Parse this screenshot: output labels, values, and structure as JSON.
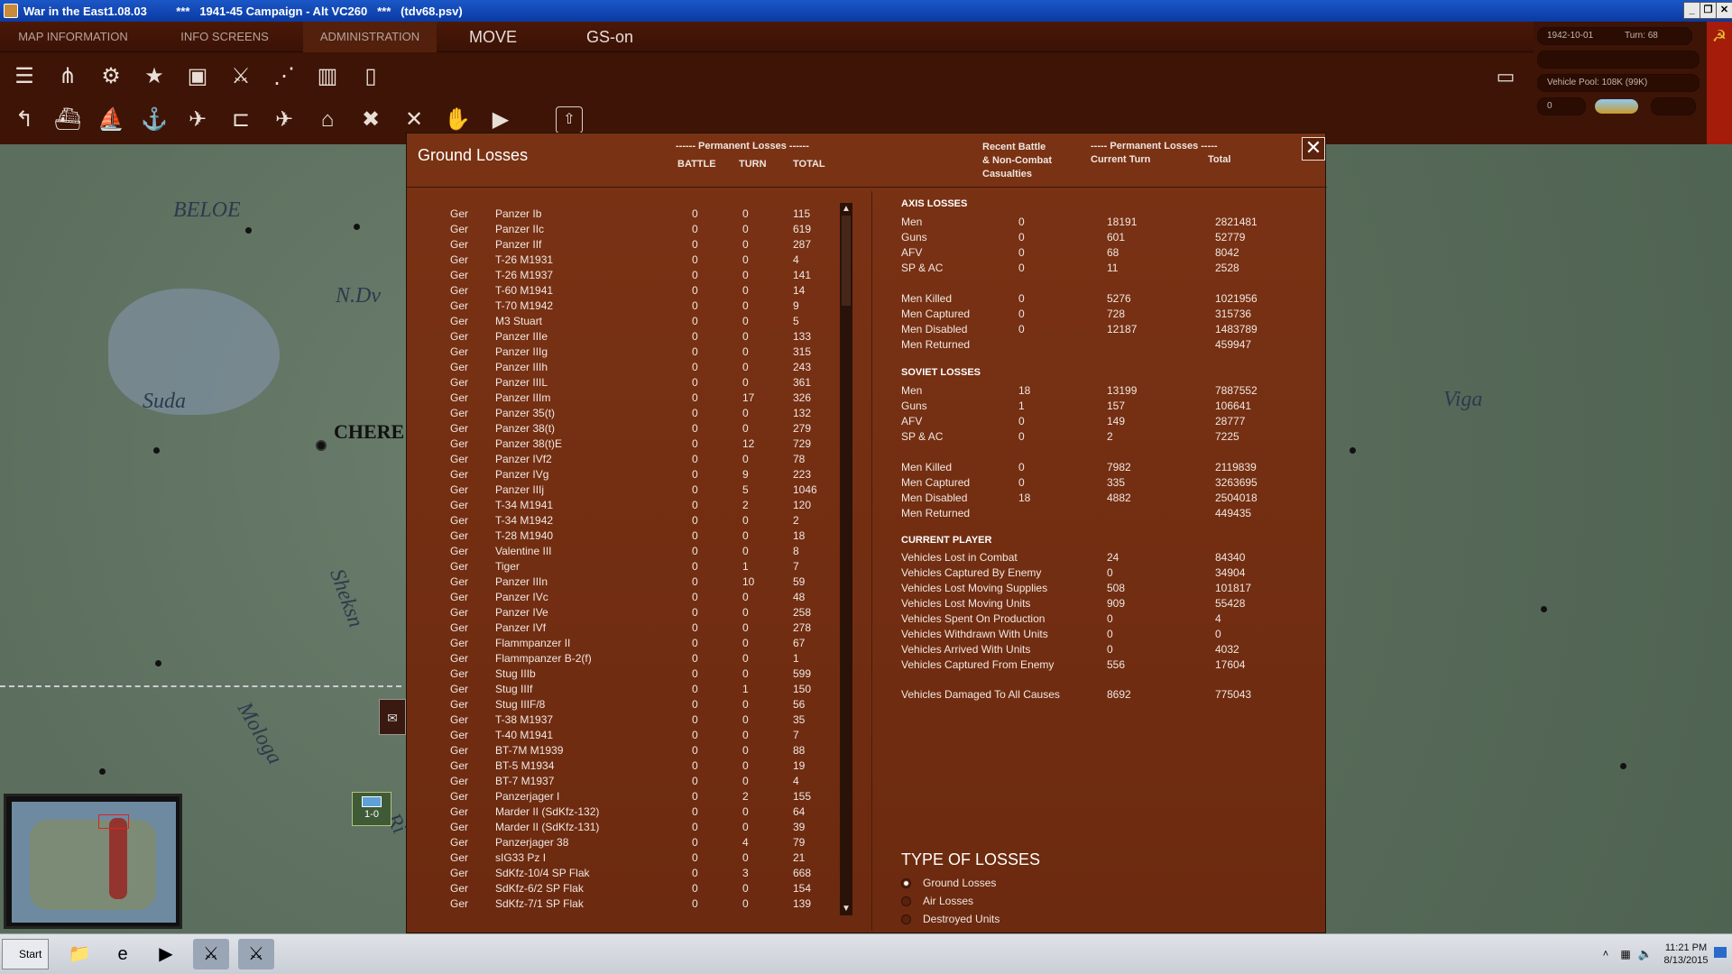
{
  "window": {
    "title": "War in the East1.08.03         ***   1941-45 Campaign - Alt VC260   ***   (tdv68.psv)",
    "minimize": "_",
    "restore": "❐",
    "close": "✕"
  },
  "menubar": {
    "tabs": [
      "MAP INFORMATION",
      "INFO SCREENS",
      "ADMINISTRATION"
    ],
    "mode": "MOVE",
    "gs": "GS-on"
  },
  "hud": {
    "date": "1942-10-01",
    "turn": "Turn: 68",
    "vehicle_pool": "Vehicle Pool: 108K (99K)",
    "small_value": "0"
  },
  "map": {
    "labels": [
      "BELOE",
      "N.Dv",
      "Suda",
      "CHERE",
      "Sheksn",
      "Mologa",
      "Viga",
      "Ri"
    ],
    "unit_label": "1-0"
  },
  "panel": {
    "title": "Ground Losses",
    "left_header_group": "------ Permanent Losses ------",
    "left_cols": [
      "BATTLE",
      "TURN",
      "TOTAL"
    ],
    "right_header_1": "Recent Battle\n& Non-Combat\nCasualties",
    "right_header_group": "----- Permanent Losses -----",
    "right_cols": [
      "Current Turn",
      "Total"
    ],
    "close_label": "✕"
  },
  "losses": [
    [
      "Ger",
      "Panzer Ib",
      "0",
      "0",
      "115"
    ],
    [
      "Ger",
      "Panzer IIc",
      "0",
      "0",
      "619"
    ],
    [
      "Ger",
      "Panzer IIf",
      "0",
      "0",
      "287"
    ],
    [
      "Ger",
      "T-26 M1931",
      "0",
      "0",
      "4"
    ],
    [
      "Ger",
      "T-26 M1937",
      "0",
      "0",
      "141"
    ],
    [
      "Ger",
      "T-60 M1941",
      "0",
      "0",
      "14"
    ],
    [
      "Ger",
      "T-70 M1942",
      "0",
      "0",
      "9"
    ],
    [
      "Ger",
      "M3 Stuart",
      "0",
      "0",
      "5"
    ],
    [
      "Ger",
      "Panzer IIIe",
      "0",
      "0",
      "133"
    ],
    [
      "Ger",
      "Panzer IIIg",
      "0",
      "0",
      "315"
    ],
    [
      "Ger",
      "Panzer IIIh",
      "0",
      "0",
      "243"
    ],
    [
      "Ger",
      "Panzer IIIL",
      "0",
      "0",
      "361"
    ],
    [
      "Ger",
      "Panzer IIIm",
      "0",
      "17",
      "326"
    ],
    [
      "Ger",
      "Panzer 35(t)",
      "0",
      "0",
      "132"
    ],
    [
      "Ger",
      "Panzer 38(t)",
      "0",
      "0",
      "279"
    ],
    [
      "Ger",
      "Panzer 38(t)E",
      "0",
      "12",
      "729"
    ],
    [
      "Ger",
      "Panzer IVf2",
      "0",
      "0",
      "78"
    ],
    [
      "Ger",
      "Panzer IVg",
      "0",
      "9",
      "223"
    ],
    [
      "Ger",
      "Panzer IIIj",
      "0",
      "5",
      "1046"
    ],
    [
      "Ger",
      "T-34 M1941",
      "0",
      "2",
      "120"
    ],
    [
      "Ger",
      "T-34 M1942",
      "0",
      "0",
      "2"
    ],
    [
      "Ger",
      "T-28 M1940",
      "0",
      "0",
      "18"
    ],
    [
      "Ger",
      "Valentine III",
      "0",
      "0",
      "8"
    ],
    [
      "Ger",
      "Tiger",
      "0",
      "1",
      "7"
    ],
    [
      "Ger",
      "Panzer IIIn",
      "0",
      "10",
      "59"
    ],
    [
      "Ger",
      "Panzer IVc",
      "0",
      "0",
      "48"
    ],
    [
      "Ger",
      "Panzer IVe",
      "0",
      "0",
      "258"
    ],
    [
      "Ger",
      "Panzer IVf",
      "0",
      "0",
      "278"
    ],
    [
      "Ger",
      "Flammpanzer II",
      "0",
      "0",
      "67"
    ],
    [
      "Ger",
      "Flammpanzer B-2(f)",
      "0",
      "0",
      "1"
    ],
    [
      "Ger",
      "Stug IIIb",
      "0",
      "0",
      "599"
    ],
    [
      "Ger",
      "Stug IIIf",
      "0",
      "1",
      "150"
    ],
    [
      "Ger",
      "Stug IIIF/8",
      "0",
      "0",
      "56"
    ],
    [
      "Ger",
      "T-38 M1937",
      "0",
      "0",
      "35"
    ],
    [
      "Ger",
      "T-40 M1941",
      "0",
      "0",
      "7"
    ],
    [
      "Ger",
      "BT-7M M1939",
      "0",
      "0",
      "88"
    ],
    [
      "Ger",
      "BT-5 M1934",
      "0",
      "0",
      "19"
    ],
    [
      "Ger",
      "BT-7 M1937",
      "0",
      "0",
      "4"
    ],
    [
      "Ger",
      "Panzerjager I",
      "0",
      "2",
      "155"
    ],
    [
      "Ger",
      "Marder II (SdKfz-132)",
      "0",
      "0",
      "64"
    ],
    [
      "Ger",
      "Marder II (SdKfz-131)",
      "0",
      "0",
      "39"
    ],
    [
      "Ger",
      "Panzerjager 38",
      "0",
      "4",
      "79"
    ],
    [
      "Ger",
      "sIG33 Pz I",
      "0",
      "0",
      "21"
    ],
    [
      "Ger",
      "SdKfz-10/4 SP Flak",
      "0",
      "3",
      "668"
    ],
    [
      "Ger",
      "SdKfz-6/2 SP Flak",
      "0",
      "0",
      "154"
    ],
    [
      "Ger",
      "SdKfz-7/1 SP Flak",
      "0",
      "0",
      "139"
    ]
  ],
  "axis": {
    "title": "AXIS LOSSES",
    "rows": [
      [
        "Men",
        "0",
        "18191",
        "2821481"
      ],
      [
        "Guns",
        "0",
        "601",
        "52779"
      ],
      [
        "AFV",
        "0",
        "68",
        "8042"
      ],
      [
        "SP & AC",
        "0",
        "11",
        "2528"
      ]
    ],
    "rows2": [
      [
        "Men Killed",
        "0",
        "5276",
        "1021956"
      ],
      [
        "Men Captured",
        "0",
        "728",
        "315736"
      ],
      [
        "Men Disabled",
        "0",
        "12187",
        "1483789"
      ],
      [
        "Men Returned",
        "",
        "",
        "459947"
      ]
    ]
  },
  "soviet": {
    "title": "SOVIET LOSSES",
    "rows": [
      [
        "Men",
        "18",
        "13199",
        "7887552"
      ],
      [
        "Guns",
        "1",
        "157",
        "106641"
      ],
      [
        "AFV",
        "0",
        "149",
        "28777"
      ],
      [
        "SP & AC",
        "0",
        "2",
        "7225"
      ]
    ],
    "rows2": [
      [
        "Men Killed",
        "0",
        "7982",
        "2119839"
      ],
      [
        "Men Captured",
        "0",
        "335",
        "3263695"
      ],
      [
        "Men Disabled",
        "18",
        "4882",
        "2504018"
      ],
      [
        "Men Returned",
        "",
        "",
        "449435"
      ]
    ]
  },
  "current_player": {
    "title": "CURRENT PLAYER",
    "rows": [
      [
        "Vehicles Lost in Combat",
        "24",
        "84340"
      ],
      [
        "Vehicles Captured By Enemy",
        "0",
        "34904"
      ],
      [
        "Vehicles Lost Moving Supplies",
        "508",
        "101817"
      ],
      [
        "Vehicles Lost Moving Units",
        "909",
        "55428"
      ],
      [
        "Vehicles Spent On Production",
        "0",
        "4"
      ],
      [
        "Vehicles Withdrawn With Units",
        "0",
        "0"
      ],
      [
        "Vehicles Arrived With Units",
        "0",
        "4032"
      ],
      [
        "Vehicles Captured From Enemy",
        "556",
        "17604"
      ]
    ],
    "damaged": [
      "Vehicles Damaged To All Causes",
      "8692",
      "775043"
    ]
  },
  "type_of_losses": {
    "title": "TYPE OF LOSSES",
    "options": [
      "Ground Losses",
      "Air Losses",
      "Destroyed Units"
    ],
    "selected": "Ground Losses"
  },
  "taskbar": {
    "start": "Start",
    "time": "11:21 PM",
    "date": "8/13/2015"
  },
  "colors": {
    "panel": "#6c2a10",
    "menubar": "#3d1406",
    "title_bar": "#0a3aa3"
  }
}
